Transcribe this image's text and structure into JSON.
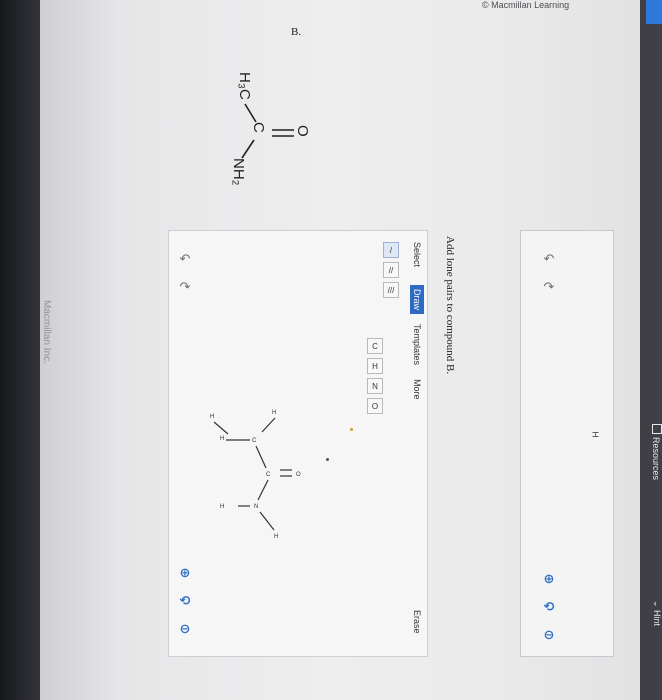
{
  "header": {
    "copyright": "© Macmillan Learning"
  },
  "watermark": "Macmillan Inc.",
  "sidebar": {
    "resources": "Resources",
    "hint": "Hint"
  },
  "problem": {
    "label": "B.",
    "structure_atoms": {
      "methyl": "H₃C",
      "carbon": "C",
      "oxygen": "O",
      "amine": "NH₂"
    }
  },
  "upper_panel": {
    "undo_icon": "undo-icon",
    "redo_icon": "redo-icon",
    "zoom_in_icon": "zoom-in-icon",
    "reset_icon": "reset-icon",
    "zoom_out_icon": "zoom-out-icon"
  },
  "main_panel": {
    "instruction": "Add lone pairs to compound B.",
    "tabs": [
      "Select",
      "Draw",
      "Templates",
      "More"
    ],
    "active_tab": "Draw",
    "erase_label": "Erase",
    "bond_tools": [
      "/",
      "//",
      "///"
    ],
    "atom_tools": [
      "C",
      "H",
      "N",
      "O"
    ],
    "molecule_atoms": {
      "h": "H",
      "c": "C",
      "n": "N",
      "o": "O"
    }
  },
  "stray_label": "H"
}
